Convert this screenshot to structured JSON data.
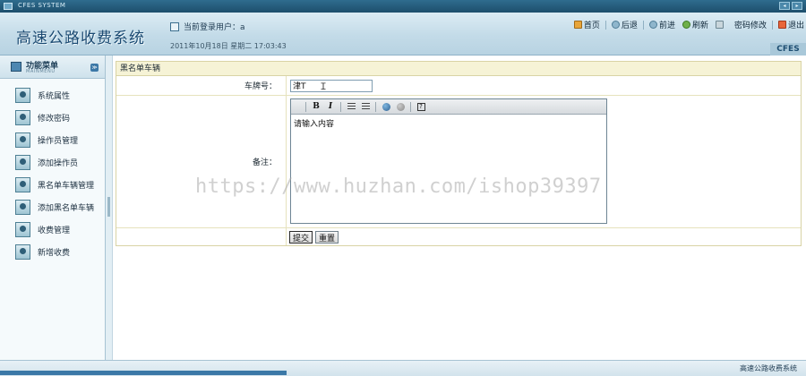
{
  "system": {
    "title": "CFES SYSTEM",
    "win_min": "◂",
    "win_max": "▸"
  },
  "header": {
    "app_title": "高速公路收费系统",
    "current_user_label": "当前登录用户：a",
    "datetime": "2011年10月18日 星期二 17:03:43",
    "brand": "CFES",
    "nav": {
      "home": "首页",
      "back": "后退",
      "forward": "前进",
      "refresh": "刷新",
      "change_password": "密码修改",
      "exit": "退出"
    }
  },
  "sidebar": {
    "title": "功能菜单",
    "subtitle": "MAINMENU",
    "collapse": "≫",
    "items": [
      {
        "label": "系统属性"
      },
      {
        "label": "修改密码"
      },
      {
        "label": "操作员管理"
      },
      {
        "label": "添加操作员"
      },
      {
        "label": "黑名单车辆管理"
      },
      {
        "label": "添加黑名单车辆"
      },
      {
        "label": "收费管理"
      },
      {
        "label": "新增收费"
      }
    ]
  },
  "form": {
    "panel_title": "黑名单车辆",
    "plate_label": "车牌号：",
    "plate_value": "津T",
    "remark_label": "备注：",
    "remark_placeholder": "请输入内容",
    "toolbar": {
      "bold": "B",
      "italic": "I",
      "help": "?"
    },
    "submit": "提交",
    "reset": "重置"
  },
  "watermark": "https://www.huzhan.com/ishop39397",
  "status": {
    "text": "高速公路收费系统"
  }
}
